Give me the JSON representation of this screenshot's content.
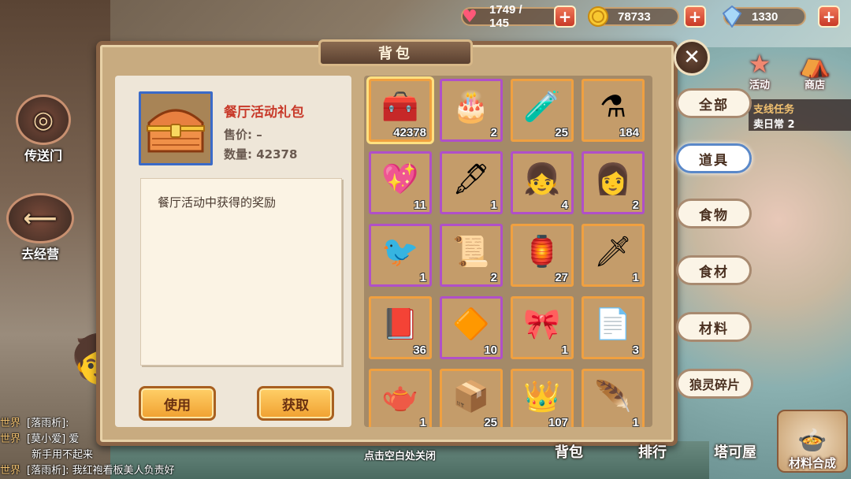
{
  "resources": {
    "hp": {
      "value": "1749 / 145",
      "icon": "heart-icon"
    },
    "gold": {
      "value": "78733",
      "icon": "coin-icon"
    },
    "gem": {
      "value": "1330",
      "icon": "crystal-icon"
    },
    "plus": "+"
  },
  "left_nav": {
    "portal": "传送门",
    "goto_business": "去经营"
  },
  "chat": [
    {
      "channel": "世界",
      "text": "[落雨析]:"
    },
    {
      "channel": "世界",
      "text": "[莫小爱] 爱"
    },
    {
      "channel": "",
      "text": "新手用不起来"
    },
    {
      "channel": "世界",
      "text": "[落雨析]: 我红袍看板美人负责好"
    }
  ],
  "panel": {
    "title": "背包",
    "close_symbol": "✕"
  },
  "detail": {
    "name": "餐厅活动礼包",
    "price": "售价: –",
    "quantity": "数量: 42378",
    "description": "餐厅活动中获得的奖励",
    "use_button": "使用",
    "get_button": "获取"
  },
  "items": [
    {
      "icon": "treasure-chest-icon",
      "glyph": "🧰",
      "count": "42378",
      "rarity": "orange",
      "selected": true
    },
    {
      "icon": "cake-chest-icon",
      "glyph": "🎂",
      "count": "2",
      "rarity": "purple"
    },
    {
      "icon": "potion-icon",
      "glyph": "🧪",
      "count": "25",
      "rarity": "orange"
    },
    {
      "icon": "potion-icon",
      "glyph": "⚗",
      "count": "184",
      "rarity": "orange"
    },
    {
      "icon": "heart-badge-icon",
      "glyph": "💖",
      "count": "11",
      "rarity": "purple"
    },
    {
      "icon": "fountain-pen-icon",
      "glyph": "🖋",
      "count": "1",
      "rarity": "purple"
    },
    {
      "icon": "character-head-icon",
      "glyph": "👧",
      "count": "4",
      "rarity": "purple"
    },
    {
      "icon": "character-head-icon",
      "glyph": "👩",
      "count": "2",
      "rarity": "purple"
    },
    {
      "icon": "magpie-icon",
      "glyph": "🐦",
      "count": "1",
      "rarity": "purple"
    },
    {
      "icon": "scroll-icon",
      "glyph": "📜",
      "count": "2",
      "rarity": "purple"
    },
    {
      "icon": "lantern-icon",
      "glyph": "🏮",
      "count": "27",
      "rarity": "orange"
    },
    {
      "icon": "sword-icon",
      "glyph": "🗡",
      "count": "1",
      "rarity": "orange"
    },
    {
      "icon": "book-icon",
      "glyph": "📕",
      "count": "36",
      "rarity": "orange"
    },
    {
      "icon": "ornament-icon",
      "glyph": "🔶",
      "count": "10",
      "rarity": "purple"
    },
    {
      "icon": "crown-ornament-icon",
      "glyph": "🎀",
      "count": "1",
      "rarity": "orange"
    },
    {
      "icon": "parchment-icon",
      "glyph": "📄",
      "count": "3",
      "rarity": "orange"
    },
    {
      "icon": "teapot-icon",
      "glyph": "🫖",
      "count": "1",
      "rarity": "orange"
    },
    {
      "icon": "box-icon",
      "glyph": "📦",
      "count": "25",
      "rarity": "orange"
    },
    {
      "icon": "tiara-icon",
      "glyph": "👑",
      "count": "107",
      "rarity": "orange"
    },
    {
      "icon": "feather-icon",
      "glyph": "🪶",
      "count": "1",
      "rarity": "orange"
    }
  ],
  "tabs": [
    {
      "label": "全部",
      "active": false
    },
    {
      "label": "道具",
      "active": true
    },
    {
      "label": "食物",
      "active": false
    },
    {
      "label": "食材",
      "active": false
    },
    {
      "label": "材料",
      "active": false
    },
    {
      "label": "狼灵碎片",
      "active": false
    }
  ],
  "top_right": {
    "activity": "活动",
    "shop": "商店",
    "quest_title": "支线任务",
    "quest_sub": "卖日常 2"
  },
  "bottom_nav": {
    "bag": "背包",
    "ranking": "排行",
    "tower": "塔可屋",
    "synthesis": "材料合成",
    "close_hint": "点击空白处关闭"
  },
  "colors": {
    "accent_red": "#c83a2a",
    "purple_rarity": "#b050c8",
    "orange_rarity": "#f0a040",
    "selected_blue": "#3a6ac8"
  }
}
